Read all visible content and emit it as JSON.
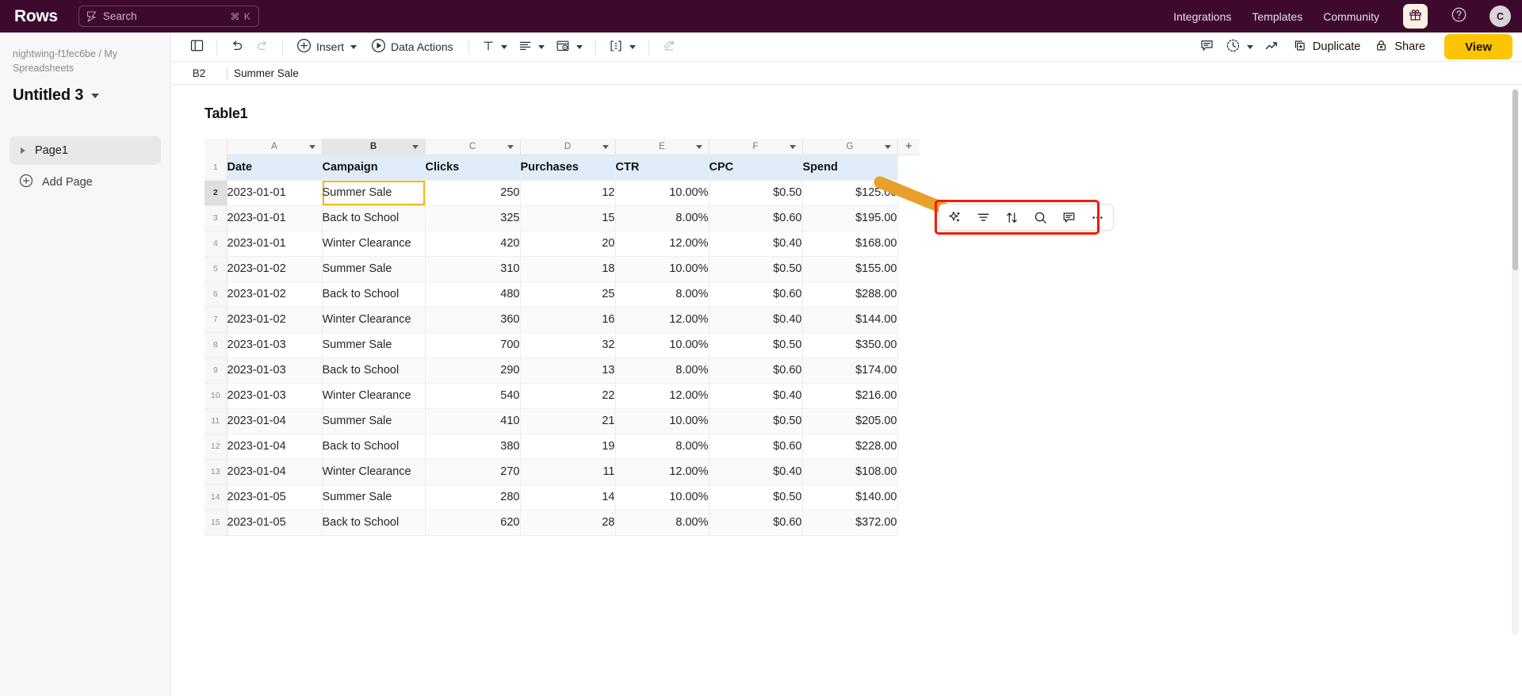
{
  "topbar": {
    "brand": "Rows",
    "search": {
      "placeholder": "Search",
      "shortcut": "⌘ K",
      "icon": "rows-logo-icon"
    },
    "nav": [
      {
        "label": "Integrations"
      },
      {
        "label": "Templates"
      },
      {
        "label": "Community"
      }
    ],
    "gift_icon": "gift-icon",
    "help_icon": "help-circle-icon",
    "avatar_initial": "C",
    "bg_color": "#3d0a2e"
  },
  "sidebar": {
    "breadcrumb": "nightwing-f1fec6be / My Spreadsheets",
    "doc_title": "Untitled 3",
    "pages": [
      {
        "label": "Page1"
      }
    ],
    "add_page_label": "Add Page"
  },
  "toolbar": {
    "panel_toggle": "sidebar-toggle-icon",
    "undo": "undo-icon",
    "redo": "redo-icon",
    "insert_label": "Insert",
    "data_actions_label": "Data Actions",
    "text_format": "text-format-icon",
    "align": "align-icon",
    "cell_style": "cell-style-icon",
    "borders": "borders-icon",
    "clear_format": "clear-format-icon",
    "comment": "comment-icon",
    "history": "history-icon",
    "chart": "chart-trend-icon",
    "duplicate_label": "Duplicate",
    "share_label": "Share",
    "view_label": "View",
    "view_color": "#fdc500"
  },
  "formula_bar": {
    "cell_ref": "B2",
    "value": "Summer Sale"
  },
  "table": {
    "name": "Table1",
    "tools": [
      {
        "name": "ai-sparkle-icon"
      },
      {
        "name": "filter-icon"
      },
      {
        "name": "sort-icon"
      },
      {
        "name": "search-icon"
      },
      {
        "name": "comment-icon"
      },
      {
        "name": "more-options-icon"
      }
    ],
    "highlight_color": "#f61a00",
    "arrow_color": "#e8a02a",
    "column_letters": [
      "A",
      "B",
      "C",
      "D",
      "E",
      "F",
      "G"
    ],
    "selected_column": "B",
    "add_column_label": "+",
    "headers": [
      "Date",
      "Campaign",
      "Clicks",
      "Purchases",
      "CTR",
      "CPC",
      "Spend"
    ],
    "active_cell": {
      "row": 2,
      "col": 1
    },
    "rows": [
      {
        "n": 2,
        "cells": [
          "2023-01-01",
          "Summer Sale",
          "250",
          "12",
          "10.00%",
          "$0.50",
          "$125.00"
        ]
      },
      {
        "n": 3,
        "cells": [
          "2023-01-01",
          "Back to School",
          "325",
          "15",
          "8.00%",
          "$0.60",
          "$195.00"
        ]
      },
      {
        "n": 4,
        "cells": [
          "2023-01-01",
          "Winter Clearance",
          "420",
          "20",
          "12.00%",
          "$0.40",
          "$168.00"
        ]
      },
      {
        "n": 5,
        "cells": [
          "2023-01-02",
          "Summer Sale",
          "310",
          "18",
          "10.00%",
          "$0.50",
          "$155.00"
        ]
      },
      {
        "n": 6,
        "cells": [
          "2023-01-02",
          "Back to School",
          "480",
          "25",
          "8.00%",
          "$0.60",
          "$288.00"
        ]
      },
      {
        "n": 7,
        "cells": [
          "2023-01-02",
          "Winter Clearance",
          "360",
          "16",
          "12.00%",
          "$0.40",
          "$144.00"
        ]
      },
      {
        "n": 8,
        "cells": [
          "2023-01-03",
          "Summer Sale",
          "700",
          "32",
          "10.00%",
          "$0.50",
          "$350.00"
        ]
      },
      {
        "n": 9,
        "cells": [
          "2023-01-03",
          "Back to School",
          "290",
          "13",
          "8.00%",
          "$0.60",
          "$174.00"
        ]
      },
      {
        "n": 10,
        "cells": [
          "2023-01-03",
          "Winter Clearance",
          "540",
          "22",
          "12.00%",
          "$0.40",
          "$216.00"
        ]
      },
      {
        "n": 11,
        "cells": [
          "2023-01-04",
          "Summer Sale",
          "410",
          "21",
          "10.00%",
          "$0.50",
          "$205.00"
        ]
      },
      {
        "n": 12,
        "cells": [
          "2023-01-04",
          "Back to School",
          "380",
          "19",
          "8.00%",
          "$0.60",
          "$228.00"
        ]
      },
      {
        "n": 13,
        "cells": [
          "2023-01-04",
          "Winter Clearance",
          "270",
          "11",
          "12.00%",
          "$0.40",
          "$108.00"
        ]
      },
      {
        "n": 14,
        "cells": [
          "2023-01-05",
          "Summer Sale",
          "280",
          "14",
          "10.00%",
          "$0.50",
          "$140.00"
        ]
      },
      {
        "n": 15,
        "cells": [
          "2023-01-05",
          "Back to School",
          "620",
          "28",
          "8.00%",
          "$0.60",
          "$372.00"
        ]
      }
    ]
  }
}
